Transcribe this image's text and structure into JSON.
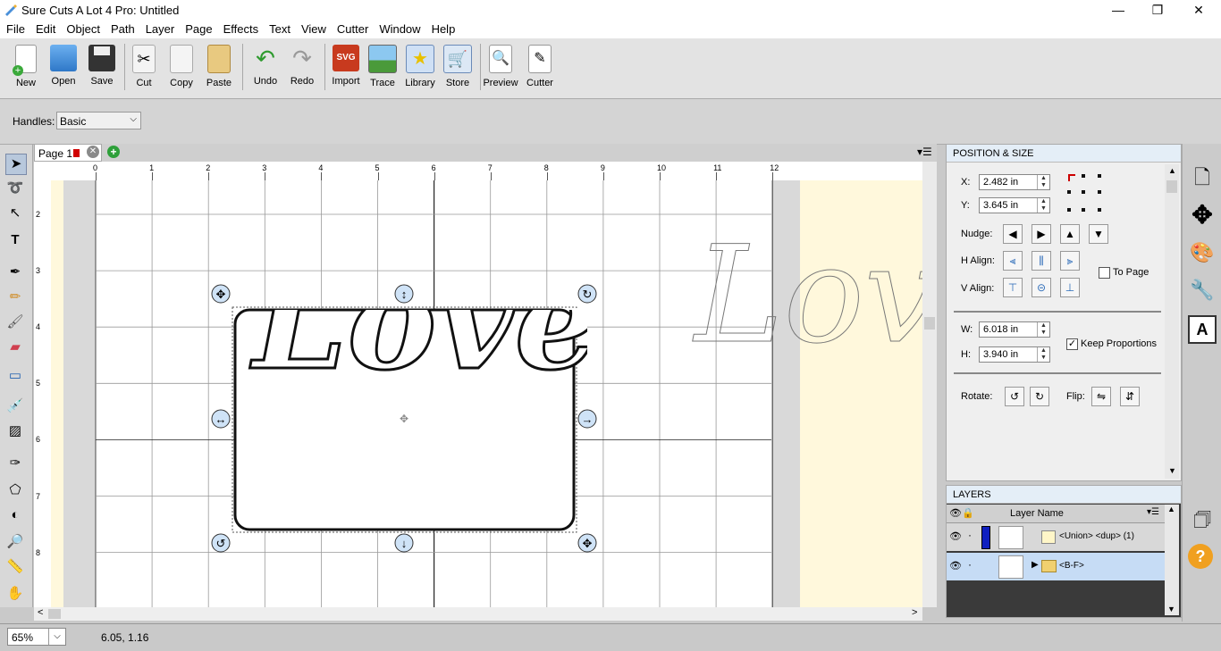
{
  "window": {
    "title": "Sure Cuts A Lot 4 Pro: Untitled",
    "minimize": "—",
    "maximize": "❐",
    "close": "✕"
  },
  "menu": [
    "File",
    "Edit",
    "Object",
    "Path",
    "Layer",
    "Page",
    "Effects",
    "Text",
    "View",
    "Cutter",
    "Window",
    "Help"
  ],
  "toolbar": {
    "new": "New",
    "open": "Open",
    "save": "Save",
    "cut": "Cut",
    "copy": "Copy",
    "paste": "Paste",
    "undo": "Undo",
    "redo": "Redo",
    "import": "Import",
    "trace": "Trace",
    "library": "Library",
    "store": "Store",
    "preview": "Preview",
    "cutter": "Cutter",
    "import_badge": "SVG"
  },
  "handles": {
    "label": "Handles:",
    "value": "Basic"
  },
  "page_tab": {
    "label": "Page 1"
  },
  "ruler_h": [
    "0",
    "1",
    "2",
    "3",
    "4",
    "5",
    "6",
    "7",
    "8",
    "9",
    "10",
    "11",
    "12"
  ],
  "ruler_v": [
    "2",
    "3",
    "4",
    "5",
    "6",
    "7",
    "8"
  ],
  "canvas": {
    "selected_text": "Love",
    "ghost_text": "Love"
  },
  "position_size": {
    "title": "POSITION & SIZE",
    "x_label": "X:",
    "x_value": "2.482 in",
    "y_label": "Y:",
    "y_value": "3.645 in",
    "nudge_label": "Nudge:",
    "halign_label": "H Align:",
    "valign_label": "V Align:",
    "to_page_label": "To Page",
    "to_page_checked": false,
    "w_label": "W:",
    "w_value": "6.018 in",
    "h_label": "H:",
    "h_value": "3.940 in",
    "keep_prop_label": "Keep Proportions",
    "keep_prop_checked": true,
    "rotate_label": "Rotate:",
    "flip_label": "Flip:"
  },
  "layers": {
    "title": "LAYERS",
    "column": "Layer Name",
    "rows": [
      {
        "name": "<Union> <dup> (1)",
        "color": "#1020c0"
      },
      {
        "name": "<B-F>",
        "color": ""
      }
    ]
  },
  "status": {
    "zoom": "65%",
    "coords": "6.05, 1.16"
  },
  "colors": {
    "accent_blue": "#1020c0",
    "page_marker_red": "#d00000",
    "selection_row": "#c6dcf5",
    "canvas_bg": "#fff8dc"
  }
}
